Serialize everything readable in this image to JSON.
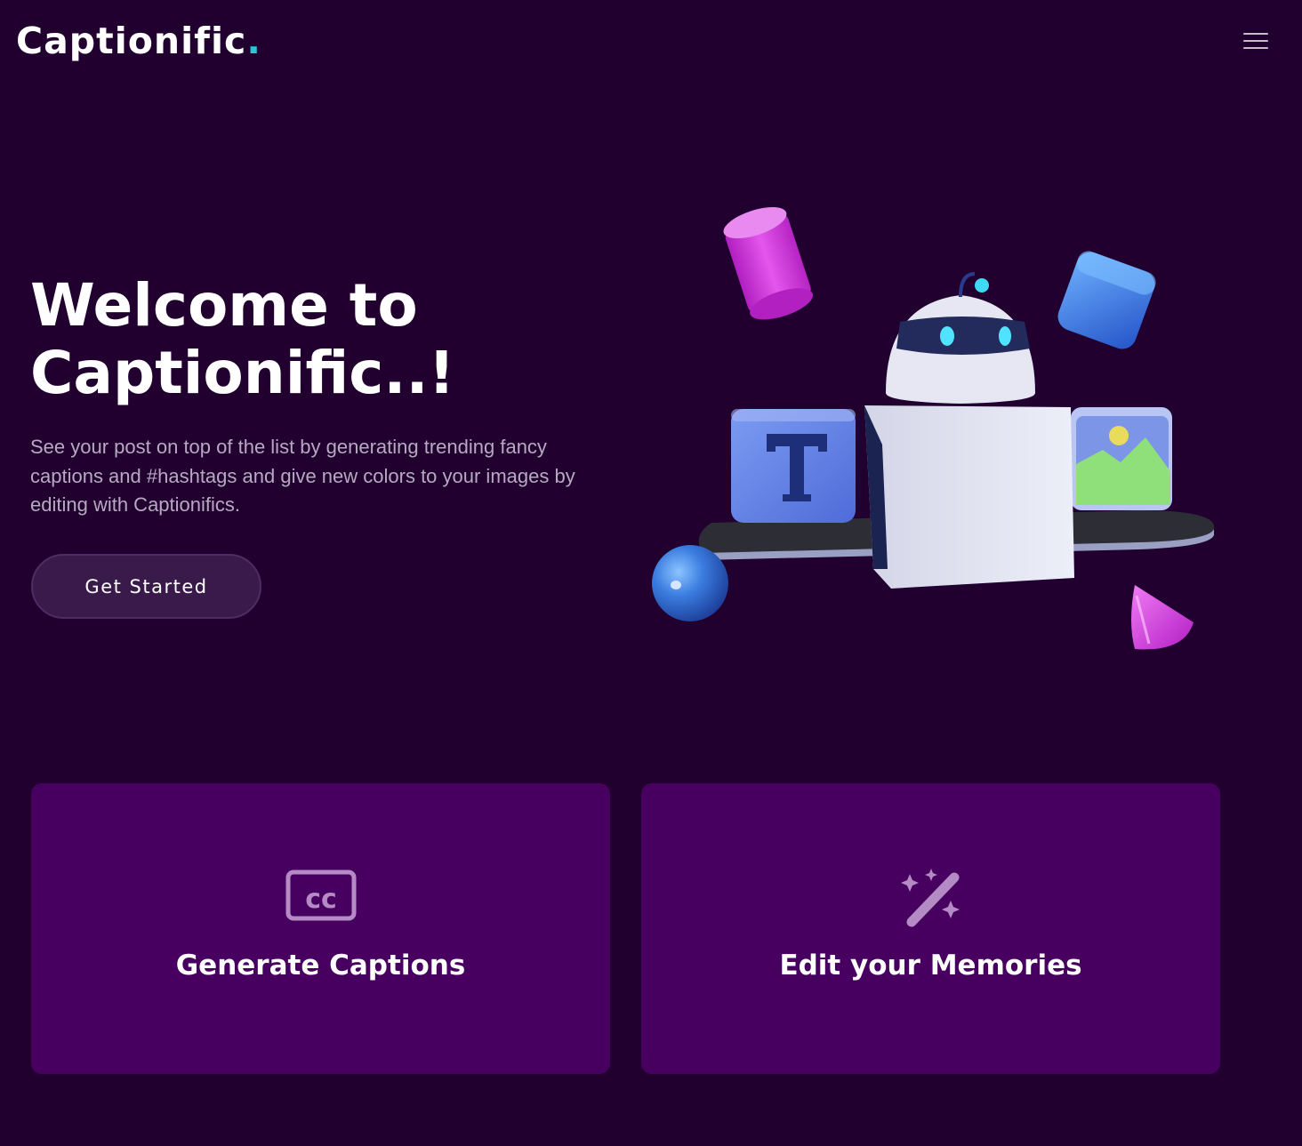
{
  "nav": {
    "brand": "Captionific",
    "brand_dot": ".",
    "menu_icon": "hamburger-menu-icon"
  },
  "hero": {
    "title_line1": "Welcome to",
    "title_line2": "Captionific..!",
    "description": "See your post on top of the list by generating trending fancy captions and #hashtags and give new colors to your images by editing with Captionifics.",
    "cta_label": "Get Started",
    "illustration": "robot-with-shapes-illustration"
  },
  "cards": [
    {
      "icon": "closed-captions-icon",
      "title": "Generate Captions"
    },
    {
      "icon": "magic-wand-icon",
      "title": "Edit your Memories"
    }
  ],
  "colors": {
    "background": "#210030",
    "card": "#480060",
    "accent_dot": "#2cc4d6",
    "button": "#3a1a4b",
    "icon": "#b48bc4"
  }
}
